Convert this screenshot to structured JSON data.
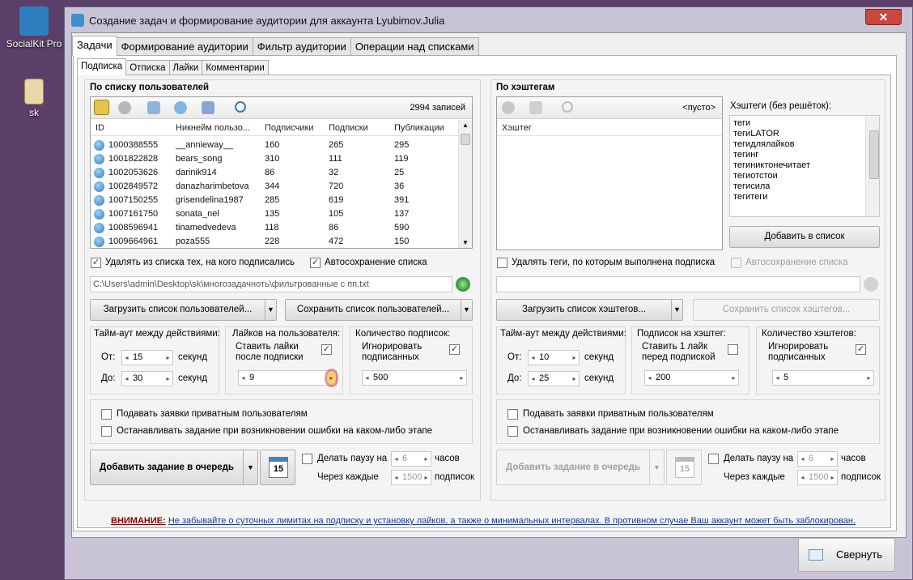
{
  "desktop": {
    "icon1_label": "SocialKit Pro",
    "icon2_label": "sk"
  },
  "window": {
    "title": "Создание задач и формирование аудитории для аккаунта Lyubimov.Julia",
    "close_label": "✕"
  },
  "main_tabs": [
    "Задачи",
    "Формирование аудитории",
    "Фильтр аудитории",
    "Операции над списками"
  ],
  "sub_tabs": [
    "Подписка",
    "Отписка",
    "Лайки",
    "Комментарии"
  ],
  "left": {
    "group_title": "По списку пользователей",
    "record_count": "2994 записей",
    "columns": [
      "ID",
      "Никнейм пользо...",
      "Подписчики",
      "Подписки",
      "Публикации"
    ],
    "rows": [
      [
        "1000388555",
        "__annieway__",
        "160",
        "265",
        "295"
      ],
      [
        "1001822828",
        "bears_song",
        "310",
        "111",
        "119"
      ],
      [
        "1002053626",
        "darinik914",
        "86",
        "32",
        "25"
      ],
      [
        "1002849572",
        "danazharimbetova",
        "344",
        "720",
        "36"
      ],
      [
        "1007150255",
        "grisendelina1987",
        "285",
        "619",
        "391"
      ],
      [
        "1007161750",
        "sonata_nel",
        "135",
        "105",
        "137"
      ],
      [
        "1008596941",
        "tinamedvedeva",
        "118",
        "86",
        "590"
      ],
      [
        "1009664961",
        "poza555",
        "228",
        "472",
        "150"
      ]
    ],
    "chk_remove": "Удалять из списка тех, на кого подписались",
    "chk_autosave": "Автосохранение списка",
    "path": "C:\\Users\\admin\\Desktop\\sk\\многозадачноть\\фильтрованные с пп.txt",
    "load_btn": "Загрузить список пользователей...",
    "save_btn": "Сохранить список пользователей...",
    "timeout_title": "Тайм-аут между действиями:",
    "from_label": "От:",
    "to_label": "До:",
    "from_val": "15",
    "to_val": "30",
    "unit_sec": "секунд",
    "likes_title": "Лайков на пользователя:",
    "likes_chk": "Ставить лайки после подписки",
    "likes_val": "9",
    "count_title": "Количество подписок:",
    "count_chk": "Игнорировать подписанных",
    "count_val": "500",
    "chk_private": "Подавать заявки приватным пользователям",
    "chk_stop": "Останавливать задание при возникновении ошибки на каком-либо этапе",
    "add_task": "Добавить задание в очередь",
    "cal_num": "15",
    "pause_label": "Делать паузу на",
    "pause_val": "6",
    "hours": "часов",
    "every_label": "Через каждые",
    "every_val": "1500",
    "subs": "подписок"
  },
  "right": {
    "group_title": "По хэштегам",
    "empty": "<пусто>",
    "col": "Хэштег",
    "tags_label": "Хэштеги (без решёток):",
    "tags": [
      "теги",
      "тегиLATOR",
      "тегидлялайков",
      "тегинг",
      "тегиниктонечитает",
      "тегиотстои",
      "тегисила",
      "тегитеги"
    ],
    "add_list": "Добавить в список",
    "chk_remove": "Удалять теги, по которым выполнена подписка",
    "chk_autosave": "Автосохранение списка",
    "load_btn": "Загрузить список хэштегов...",
    "save_btn": "Сохранить список хэштегов...",
    "timeout_title": "Тайм-аут между действиями:",
    "from_label": "От:",
    "to_label": "До:",
    "from_val": "10",
    "to_val": "25",
    "unit_sec": "секунд",
    "per_tag_title": "Подписок на хэштег:",
    "per_tag_chk": "Ставить 1 лайк перед подпиской",
    "per_tag_val": "200",
    "count_title": "Количество хэштегов:",
    "count_chk": "Игнорировать подписанных",
    "count_val": "5",
    "chk_private": "Подавать заявки приватным пользователям",
    "chk_stop": "Останавливать задание при возникновении ошибки на каком-либо этапе",
    "add_task": "Добавить задание в очередь",
    "cal_num": "15",
    "pause_label": "Делать паузу на",
    "pause_val": "6",
    "hours": "часов",
    "every_label": "Через каждые",
    "every_val": "1500",
    "subs": "подписок"
  },
  "warning": {
    "prefix": "ВНИМАНИЕ:",
    "text": "Не забывайте о суточных лимитах на подписку и установку лайков, а также о минимальных интервалах. В противном случае Ваш аккаунт может быть заблокирован."
  },
  "collapse_btn": "Свернуть",
  "colors": {
    "desktop": "#5a3f69",
    "accent": "#2f7fc0",
    "warning": "#8b0000",
    "link": "#1a3a9c"
  }
}
